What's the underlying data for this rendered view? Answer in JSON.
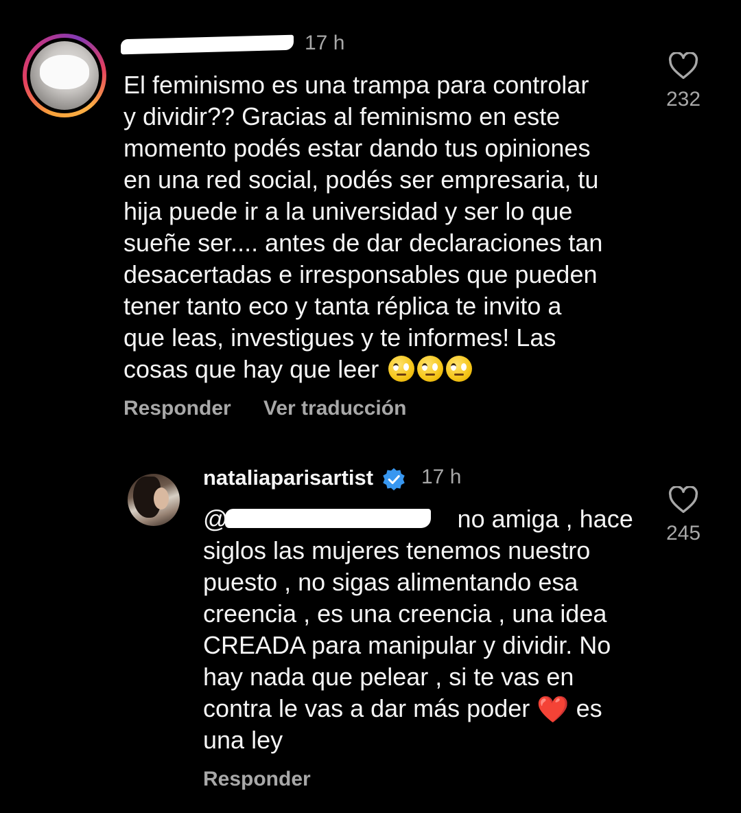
{
  "comment": {
    "author_redacted": true,
    "time": "17 h",
    "text_lines": [
      "El feminismo es una trampa para controlar",
      "y dividir?? Gracias al feminismo en este",
      "momento podés estar dando tus opiniones",
      "en una red social, podés ser empresaria, tu",
      "hija puede ir a la universidad y ser lo que",
      "sueñe ser.... antes de dar declaraciones tan",
      "desacertadas e irresponsables que pueden",
      "tener tanto eco y tanta réplica te invito a",
      "que leas, investigues y te informes! Las",
      "cosas que hay que leer"
    ],
    "trailing_emoji": [
      "face-with-rolling-eyes",
      "face-with-rolling-eyes",
      "face-with-rolling-eyes"
    ],
    "reply_label": "Responder",
    "translate_label": "Ver traducción",
    "likes": "232",
    "like_icon": "heart-outline-icon"
  },
  "reply": {
    "username": "nataliaparisartist",
    "verified_icon": "verified-badge-icon",
    "verified_color": "#3897f0",
    "time": "17 h",
    "mention_prefix": "@",
    "text_lines": [
      "no amiga , hace",
      "siglos las mujeres tenemos nuestro",
      "puesto , no sigas alimentando esa",
      "creencia , es una creencia , una idea",
      "CREADA para manipular y dividir. No",
      "hay nada que pelear , si te vas en",
      "contra le vas a dar más poder",
      "es",
      "una ley"
    ],
    "heart_emoji": "❤️",
    "reply_label": "Responder",
    "likes": "245",
    "like_icon": "heart-outline-icon"
  },
  "colors": {
    "background": "#000000",
    "text": "#f5f5f5",
    "muted": "#a8a8a8",
    "heart_red": "#e0242a"
  }
}
